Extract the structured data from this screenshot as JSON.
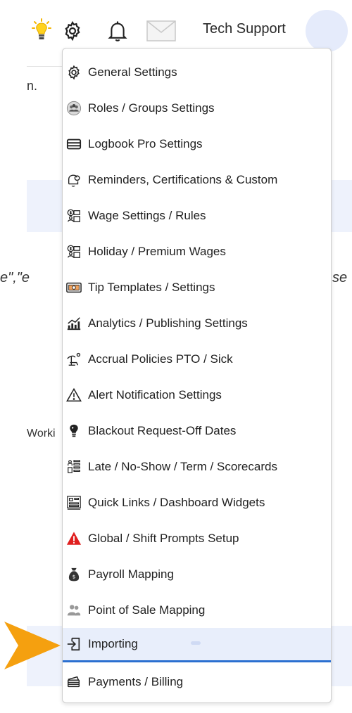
{
  "topbar": {
    "icons": [
      "lightbulb-icon",
      "gear-icon",
      "bell-icon",
      "mail-icon"
    ],
    "user_name": "Tech Support"
  },
  "background": {
    "text_fragment_1": "n.",
    "quote_fragment": "e\",\"e",
    "right_fragment": "se",
    "working_fragment": "Worki"
  },
  "menu": {
    "items": [
      {
        "label": "General Settings",
        "icon": "gear-icon"
      },
      {
        "label": "Roles / Groups Settings",
        "icon": "roles-icon"
      },
      {
        "label": "Logbook Pro Settings",
        "icon": "logbook-icon"
      },
      {
        "label": "Reminders, Certifications & Custom",
        "icon": "reminder-bell-icon"
      },
      {
        "label": "Wage Settings / Rules",
        "icon": "wage-icon"
      },
      {
        "label": "Holiday / Premium Wages",
        "icon": "holiday-wage-icon"
      },
      {
        "label": "Tip Templates / Settings",
        "icon": "tip-icon"
      },
      {
        "label": "Analytics / Publishing Settings",
        "icon": "analytics-icon"
      },
      {
        "label": "Accrual Policies PTO / Sick",
        "icon": "accrual-icon"
      },
      {
        "label": "Alert Notification Settings",
        "icon": "alert-triangle-icon"
      },
      {
        "label": "Blackout Request-Off Dates",
        "icon": "blackout-icon"
      },
      {
        "label": "Late / No-Show / Term / Scorecards",
        "icon": "scorecard-icon"
      },
      {
        "label": "Quick Links / Dashboard Widgets",
        "icon": "dashboard-icon"
      },
      {
        "label": "Global / Shift Prompts Setup",
        "icon": "warning-red-icon"
      },
      {
        "label": "Payroll Mapping",
        "icon": "payroll-bag-icon"
      },
      {
        "label": "Point of Sale Mapping",
        "icon": "pos-users-icon"
      },
      {
        "label": "Importing",
        "icon": "import-icon",
        "active": true
      },
      {
        "label": "Payments / Billing",
        "icon": "payments-icon"
      }
    ]
  },
  "colors": {
    "accent": "#2b6fd0",
    "active_bg": "#e8eefb",
    "arrow": "#f5a00f",
    "alert_red": "#e02020",
    "band": "#eef2fc"
  }
}
